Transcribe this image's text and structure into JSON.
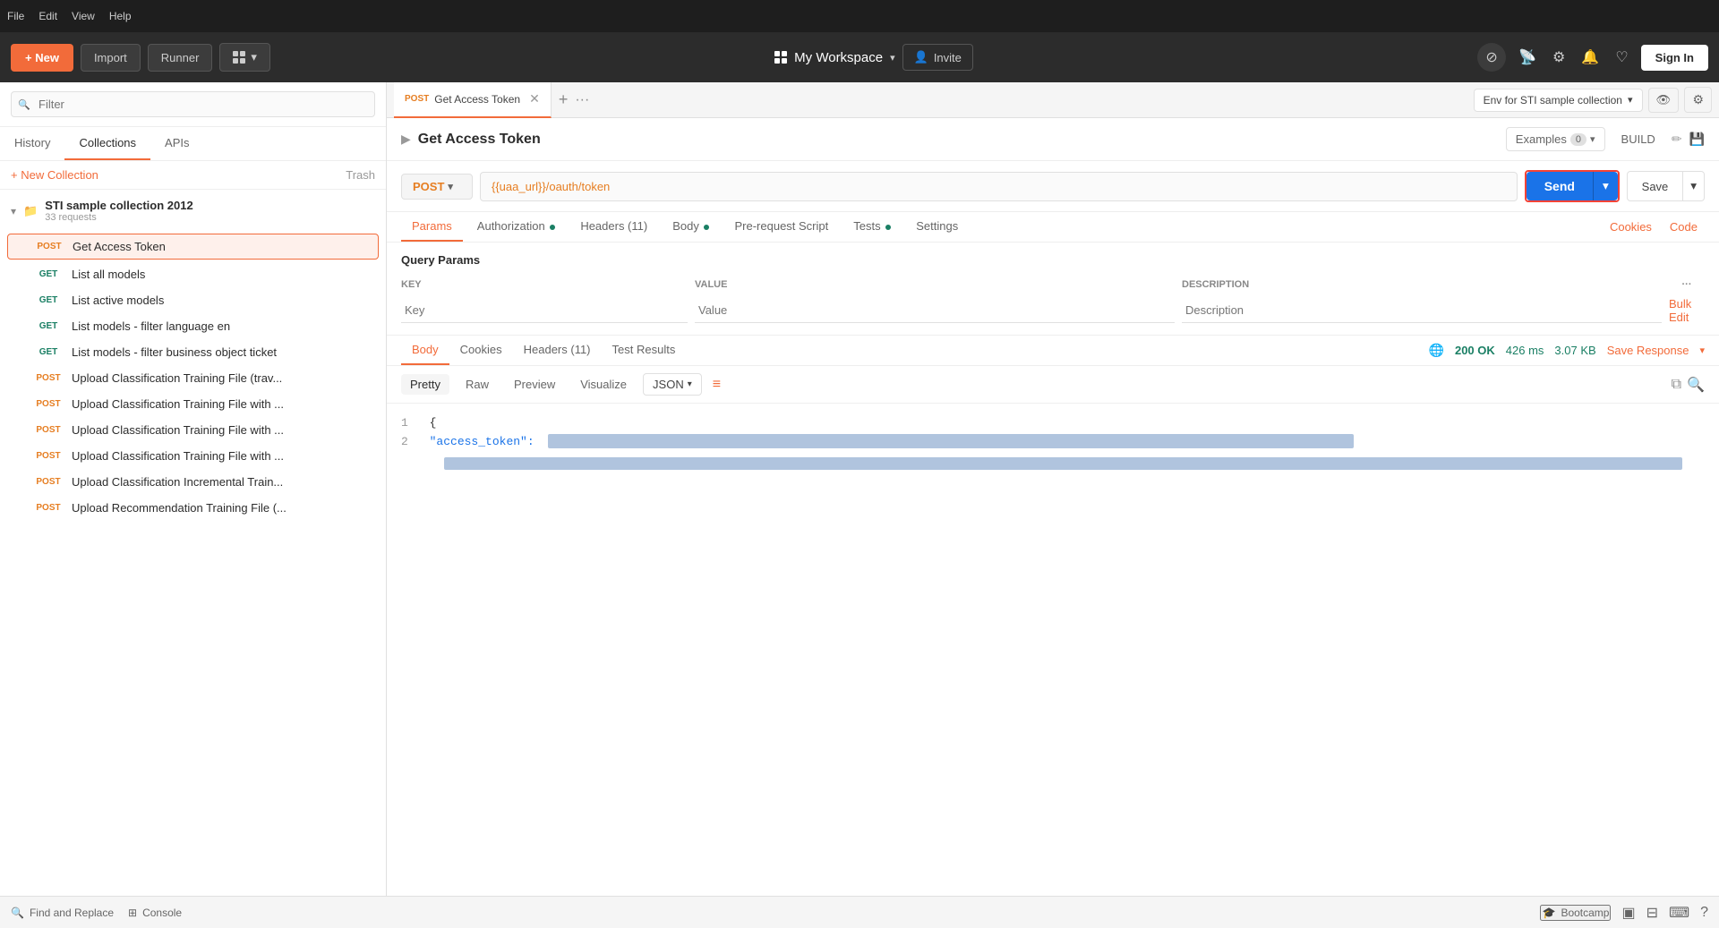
{
  "topbar": {
    "new_label": "+ New",
    "import_label": "Import",
    "runner_label": "Runner",
    "workspace_label": "My Workspace",
    "invite_label": "Invite",
    "signin_label": "Sign In"
  },
  "menu": {
    "file": "File",
    "edit": "Edit",
    "view": "View",
    "help": "Help"
  },
  "sidebar": {
    "search_placeholder": "Filter",
    "tabs": [
      "History",
      "Collections",
      "APIs"
    ],
    "active_tab": "Collections",
    "new_collection": "+ New Collection",
    "trash": "Trash",
    "collection_name": "STI sample collection 2012",
    "collection_count": "33 requests",
    "requests": [
      {
        "method": "POST",
        "name": "Get Access Token",
        "active": true
      },
      {
        "method": "GET",
        "name": "List all models",
        "active": false
      },
      {
        "method": "GET",
        "name": "List active models",
        "active": false
      },
      {
        "method": "GET",
        "name": "List models - filter language en",
        "active": false
      },
      {
        "method": "GET",
        "name": "List models - filter business object ticket",
        "active": false
      },
      {
        "method": "POST",
        "name": "Upload Classification Training File (trav...",
        "active": false
      },
      {
        "method": "POST",
        "name": "Upload Classification Training File with ...",
        "active": false
      },
      {
        "method": "POST",
        "name": "Upload Classification Training File with ...",
        "active": false
      },
      {
        "method": "POST",
        "name": "Upload Classification Training File with ...",
        "active": false
      },
      {
        "method": "POST",
        "name": "Upload Classification Incremental Train...",
        "active": false
      },
      {
        "method": "POST",
        "name": "Upload Recommendation Training File (...",
        "active": false
      }
    ]
  },
  "request": {
    "tab_method": "POST",
    "tab_name": "Get Access Token",
    "title": "Get Access Token",
    "examples_label": "Examples",
    "examples_count": "0",
    "build_label": "BUILD",
    "method": "POST",
    "url": "{{uaa_url}}/oauth/token",
    "send_label": "Send",
    "save_label": "Save",
    "tabs": [
      "Params",
      "Authorization",
      "Headers (11)",
      "Body",
      "Pre-request Script",
      "Tests",
      "Settings"
    ],
    "cookies_label": "Cookies",
    "code_label": "Code",
    "active_tab": "Params",
    "query_params": {
      "title": "Query Params",
      "headers": [
        "KEY",
        "VALUE",
        "DESCRIPTION"
      ],
      "key_placeholder": "Key",
      "value_placeholder": "Value",
      "description_placeholder": "Description",
      "bulk_edit_label": "Bulk Edit"
    }
  },
  "response": {
    "tabs": [
      "Body",
      "Cookies",
      "Headers (11)",
      "Test Results"
    ],
    "active_tab": "Body",
    "status": "200 OK",
    "time": "426 ms",
    "size": "3.07 KB",
    "save_response_label": "Save Response",
    "format_tabs": [
      "Pretty",
      "Raw",
      "Preview",
      "Visualize"
    ],
    "active_format": "Pretty",
    "json_label": "JSON",
    "line1": "{",
    "line2_key": "\"access_token\":",
    "line_num1": "1",
    "line_num2": "2"
  },
  "env": {
    "label": "Env for STI sample collection"
  },
  "bottom": {
    "find_replace": "Find and Replace",
    "console": "Console",
    "bootcamp": "Bootcamp"
  }
}
